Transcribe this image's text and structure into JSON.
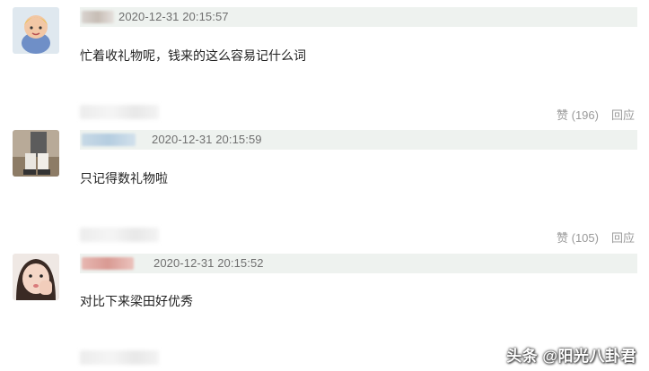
{
  "comments": [
    {
      "timestamp": "2020-12-31 20:15:57",
      "text": "忙着收礼物呢，钱来的这么容易记什么词",
      "like_label": "赞 (196)",
      "reply_label": "回应"
    },
    {
      "timestamp": "2020-12-31 20:15:59",
      "text": "只记得数礼物啦",
      "like_label": "赞 (105)",
      "reply_label": "回应"
    },
    {
      "timestamp": "2020-12-31 20:15:52",
      "text": "对比下来梁田好优秀"
    }
  ],
  "watermark": "头条 @阳光八卦君",
  "colors": {
    "meta_bar_bg": "#eef2ef",
    "timestamp": "#6f6f6f",
    "action_text": "#9a9a9a"
  }
}
